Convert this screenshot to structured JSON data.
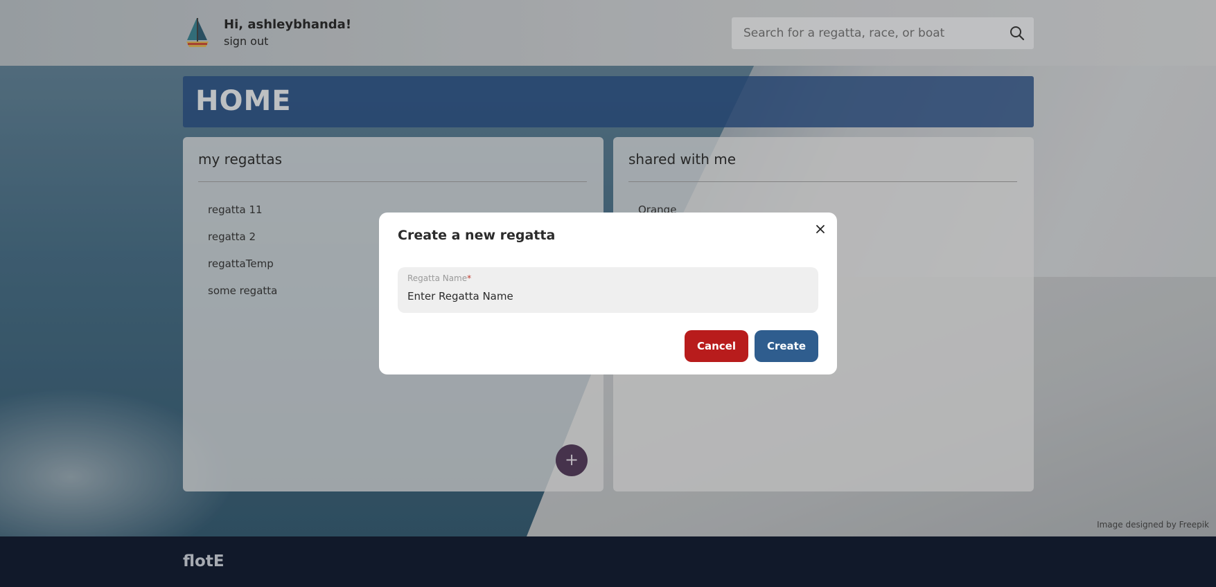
{
  "header": {
    "greeting": "Hi, ashleybhanda!",
    "signout": "sign out",
    "search_placeholder": "Search for a regatta, race, or boat"
  },
  "banner": {
    "title": "HOME"
  },
  "my_regattas": {
    "heading": "my regattas",
    "items": [
      "regatta 11",
      "regatta 2",
      "regattaTemp",
      "some regatta"
    ],
    "add_label": "+"
  },
  "shared": {
    "heading": "shared with me",
    "items": [
      "Orange"
    ]
  },
  "modal": {
    "title": "Create a new regatta",
    "field_label": "Regatta Name",
    "required_mark": "*",
    "field_placeholder": "Enter Regatta Name",
    "cancel_label": "Cancel",
    "create_label": "Create"
  },
  "credit": "Image designed by Freepik",
  "footer": {
    "brand": "flotE"
  },
  "colors": {
    "banner": "#1c4680",
    "cancel": "#b81c1c",
    "create": "#2f5d8e",
    "add_button": "#4a3152",
    "footer": "#11192a"
  }
}
